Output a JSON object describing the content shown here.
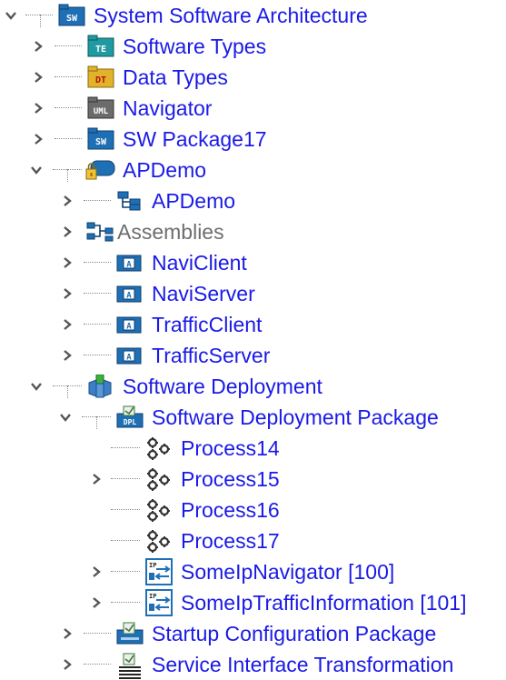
{
  "tree": {
    "root": {
      "label": "System Software Architecture",
      "icon": "sw-package-icon"
    },
    "software_types": {
      "label": "Software Types",
      "icon": "te-package-icon"
    },
    "data_types": {
      "label": "Data Types",
      "icon": "dt-package-icon"
    },
    "navigator": {
      "label": "Navigator",
      "icon": "uml-package-icon"
    },
    "sw_package17": {
      "label": "SW Package17",
      "icon": "sw-package-icon"
    },
    "apdemo_folder": {
      "label": "APDemo",
      "icon": "locked-system-icon"
    },
    "apdemo_composition": {
      "label": "APDemo",
      "icon": "composition-icon"
    },
    "assemblies": {
      "label": "Assemblies",
      "icon": "assemblies-icon"
    },
    "navi_client": {
      "label": "NaviClient",
      "icon": "application-component-icon"
    },
    "navi_server": {
      "label": "NaviServer",
      "icon": "application-component-icon"
    },
    "traffic_client": {
      "label": "TrafficClient",
      "icon": "application-component-icon"
    },
    "traffic_server": {
      "label": "TrafficServer",
      "icon": "application-component-icon"
    },
    "software_deployment": {
      "label": "Software Deployment",
      "icon": "deployment-icon"
    },
    "software_deployment_package": {
      "label": "Software Deployment Package",
      "icon": "dpl-package-icon"
    },
    "process14": {
      "label": "Process14",
      "icon": "process-gears-icon"
    },
    "process15": {
      "label": "Process15",
      "icon": "process-gears-icon"
    },
    "process16": {
      "label": "Process16",
      "icon": "process-gears-icon"
    },
    "process17": {
      "label": "Process17",
      "icon": "process-gears-icon"
    },
    "someip_navigator": {
      "label": "SomeIpNavigator [100]",
      "icon": "someip-service-icon"
    },
    "someip_traffic": {
      "label": "SomeIpTrafficInformation [101]",
      "icon": "someip-service-icon"
    },
    "startup_configuration": {
      "label": "Startup Configuration Package",
      "icon": "startup-package-icon"
    },
    "service_interface_transformation": {
      "label": "Service Interface Transformation",
      "icon": "transformation-icon"
    }
  },
  "colors": {
    "link_text": "#1a1ae6",
    "grey_text": "#6e6e6e",
    "chevron": "#555555",
    "package_blue": "#1f6fb5",
    "package_teal": "#1f9aa0",
    "package_yellow": "#e2b22a",
    "package_grey": "#6b6b6b"
  }
}
